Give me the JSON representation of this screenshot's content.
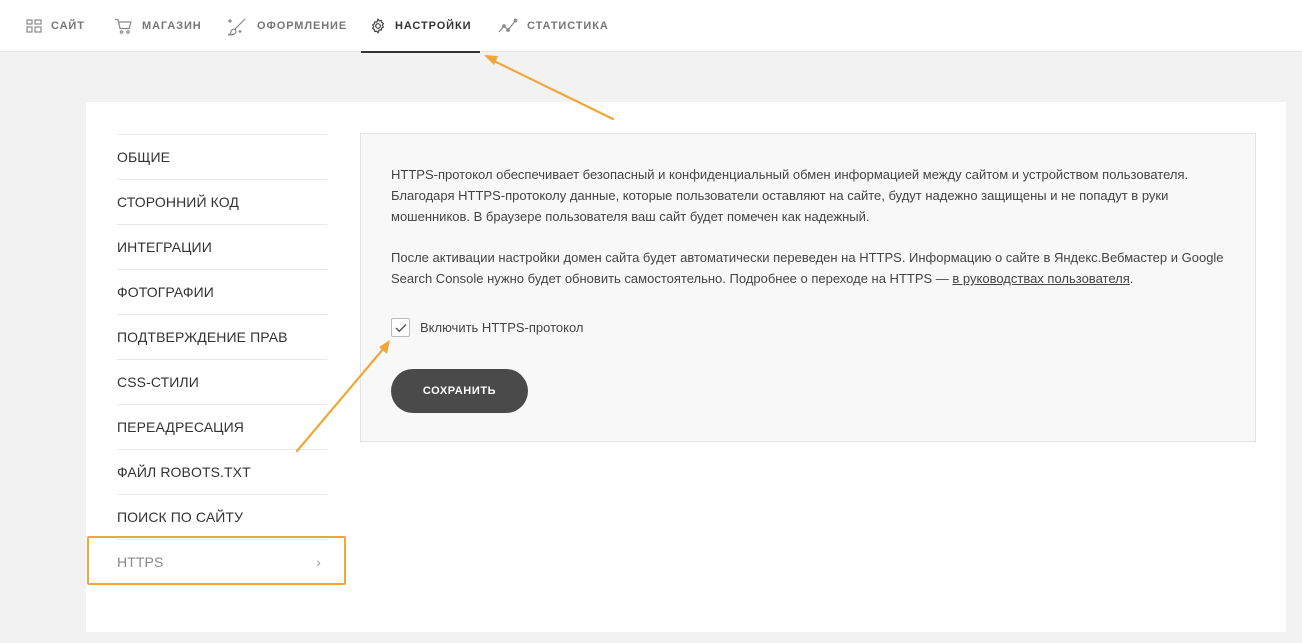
{
  "topnav": {
    "items": [
      {
        "label": "САЙТ",
        "icon": "grid-icon"
      },
      {
        "label": "МАГАЗИН",
        "icon": "cart-icon"
      },
      {
        "label": "ОФОРМЛЕНИЕ",
        "icon": "brush-icon"
      },
      {
        "label": "НАСТРОЙКИ",
        "icon": "gear-icon",
        "active": true
      },
      {
        "label": "СТАТИСТИКА",
        "icon": "chart-line-icon"
      }
    ]
  },
  "sidebar": {
    "items": [
      {
        "label": "ОБЩИЕ"
      },
      {
        "label": "СТОРОННИЙ КОД"
      },
      {
        "label": "ИНТЕГРАЦИИ"
      },
      {
        "label": "ФОТОГРАФИИ"
      },
      {
        "label": "ПОДТВЕРЖДЕНИЕ ПРАВ"
      },
      {
        "label": "CSS-СТИЛИ"
      },
      {
        "label": "ПЕРЕАДРЕСАЦИЯ"
      },
      {
        "label": "ФАЙЛ ROBOTS.TXT"
      },
      {
        "label": "ПОИСК ПО САЙТУ"
      },
      {
        "label": "HTTPS",
        "active": true,
        "chevron": "›"
      }
    ]
  },
  "panel": {
    "paragraph1": "HTTPS-протокол обеспечивает безопасный и конфиденциальный обмен информацией между сайтом и устройством пользователя. Благодаря HTTPS-протоколу данные, которые пользователи оставляют на сайте, будут надежно защищены и не попадут в руки мошенников. В браузере пользователя ваш сайт будет помечен как надежный.",
    "paragraph2_text": "После активации настройки домен сайта будет автоматически переведен на HTTPS. Информацию о сайте в Яндекс.Вебмастер и Google Search Console нужно будет обновить самостоятельно. Подробнее о переходе на HTTPS — ",
    "paragraph2_link": "в руководствах пользователя",
    "paragraph2_end": ".",
    "checkbox_label": "Включить HTTPS-протокол",
    "checkbox_checked": true,
    "save_label": "СОХРАНИТЬ"
  },
  "colors": {
    "annotation_orange": "#f0a736",
    "button_dark": "#4a4a4a",
    "background": "#f2f2f2"
  }
}
